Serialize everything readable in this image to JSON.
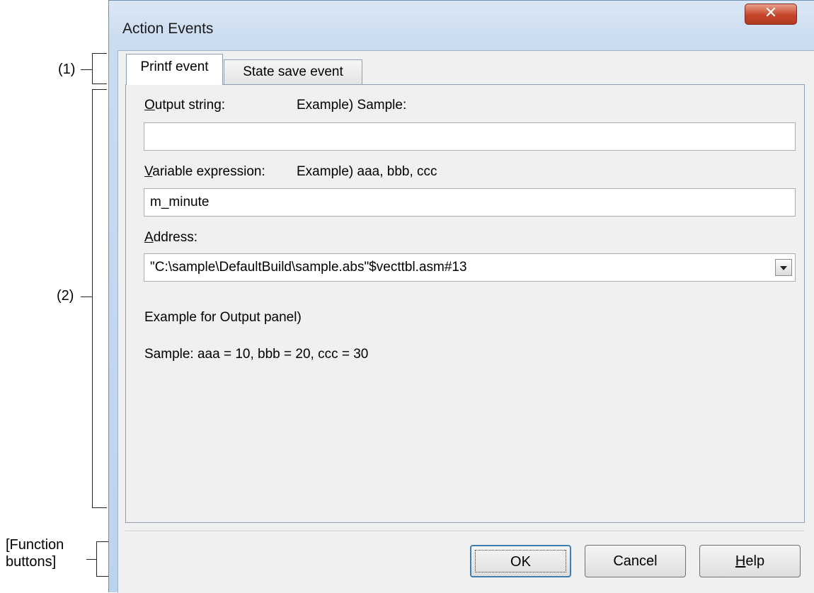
{
  "annotations": {
    "callout_1": "(1)",
    "callout_2": "(2)",
    "callout_function_line1": "[Function",
    "callout_function_line2": "buttons]"
  },
  "window": {
    "title": "Action Events",
    "close_glyph": "✕"
  },
  "tabs": [
    {
      "label": "Printf event",
      "active": true
    },
    {
      "label": "State save event",
      "active": false
    }
  ],
  "form": {
    "output_string": {
      "label_underlined": "O",
      "label_rest": "utput string:",
      "example": "Example) Sample:",
      "value": ""
    },
    "variable_expression": {
      "label_underlined": "V",
      "label_rest": "ariable expression:",
      "example": "Example) aaa, bbb, ccc",
      "value": "m_minute"
    },
    "address": {
      "label_underlined": "A",
      "label_rest": "ddress:",
      "value": "\"C:\\sample\\DefaultBuild\\sample.abs\"$vecttbl.asm#13"
    },
    "output_example_heading": "Example for Output panel)",
    "output_example_text": "Sample: aaa = 10, bbb = 20, ccc = 30"
  },
  "buttons": {
    "ok": "OK",
    "cancel": "Cancel",
    "help_underlined": "H",
    "help_rest": "elp"
  },
  "colors": {
    "titlebar": "#c9dcf0",
    "close_button": "#c6452b",
    "dialog_face": "#f0f0f0",
    "default_button_border": "#3c7fb1"
  }
}
